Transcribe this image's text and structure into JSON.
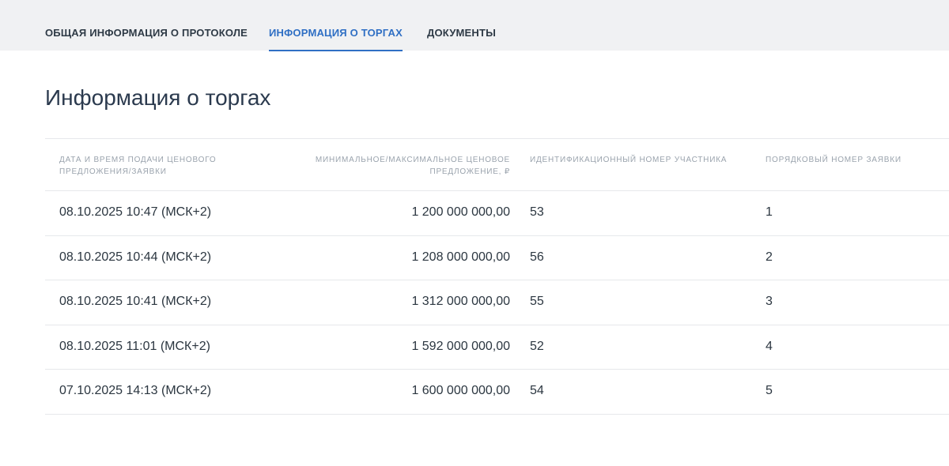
{
  "tabs": {
    "general": "ОБЩАЯ ИНФОРМАЦИЯ О ПРОТОКОЛЕ",
    "trade": "ИНФОРМАЦИЯ О ТОРГАХ",
    "docs": "ДОКУМЕНТЫ",
    "active": "trade"
  },
  "page_title": "Информация о торгах",
  "table": {
    "headers": [
      "ДАТА И ВРЕМЯ ПОДАЧИ ЦЕНОВОГО ПРЕДЛОЖЕНИЯ/ЗАЯВКИ",
      "МИНИМАЛЬНОЕ/МАКСИМАЛЬНОЕ ЦЕНОВОЕ ПРЕДЛОЖЕНИЕ, ₽",
      "ИДЕНТИФИКАЦИОННЫЙ НОМЕР УЧАСТНИКА",
      "ПОРЯДКОВЫЙ НОМЕР ЗАЯВКИ"
    ],
    "rows": [
      [
        "08.10.2025 10:47 (МСК+2)",
        "1 200 000 000,00",
        "53",
        "1"
      ],
      [
        "08.10.2025 10:44 (МСК+2)",
        "1 208 000 000,00",
        "56",
        "2"
      ],
      [
        "08.10.2025 10:41 (МСК+2)",
        "1 312 000 000,00",
        "55",
        "3"
      ],
      [
        "08.10.2025 11:01 (МСК+2)",
        "1 592 000 000,00",
        "52",
        "4"
      ],
      [
        "07.10.2025 14:13 (МСК+2)",
        "1 600 000 000,00",
        "54",
        "5"
      ]
    ]
  },
  "colors": {
    "accent": "#2f6fc4",
    "topbar_bg": "#f0f1f3",
    "header_text": "#9aa3ad",
    "divider": "#e6e8eb"
  }
}
